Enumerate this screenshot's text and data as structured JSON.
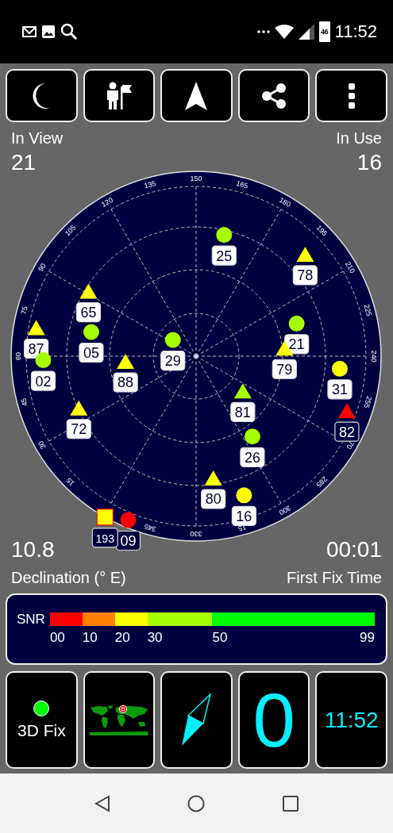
{
  "status_bar": {
    "battery": "46",
    "time": "11:52"
  },
  "toolbar": {
    "buttons": [
      {
        "kind": "moon"
      },
      {
        "kind": "person-flag"
      },
      {
        "kind": "navigation"
      },
      {
        "kind": "share"
      },
      {
        "kind": "more"
      }
    ]
  },
  "in_view": {
    "label": "In View",
    "value": "21"
  },
  "in_use": {
    "label": "In Use",
    "value": "16"
  },
  "sky_plot": {
    "azimuth_labels": [
      "15",
      "30",
      "45",
      "60",
      "75",
      "90",
      "105",
      "120",
      "135",
      "150",
      "165",
      "180",
      "195",
      "210",
      "225",
      "240",
      "255",
      "70",
      "285",
      "300",
      "15",
      "330",
      "345"
    ],
    "satellites": [
      {
        "id": "25",
        "kind": "circle",
        "color": "#a5ff00",
        "in_use": true
      },
      {
        "id": "78",
        "kind": "triangle",
        "color": "#ffff00",
        "in_use": true
      },
      {
        "id": "65",
        "kind": "triangle",
        "color": "#ffff00",
        "in_use": true
      },
      {
        "id": "87",
        "kind": "triangle",
        "color": "#ffff00",
        "in_use": true
      },
      {
        "id": "05",
        "kind": "circle",
        "color": "#a5ff00",
        "in_use": true
      },
      {
        "id": "29",
        "kind": "circle",
        "color": "#a5ff00",
        "in_use": true
      },
      {
        "id": "21",
        "kind": "circle",
        "color": "#a5ff00",
        "in_use": true
      },
      {
        "id": "79",
        "kind": "triangle",
        "color": "#ffff00",
        "in_use": true
      },
      {
        "id": "02",
        "kind": "circle",
        "color": "#a5ff00",
        "in_use": true
      },
      {
        "id": "88",
        "kind": "triangle",
        "color": "#ffff00",
        "in_use": true
      },
      {
        "id": "31",
        "kind": "circle",
        "color": "#ffff00",
        "in_use": true
      },
      {
        "id": "81",
        "kind": "triangle",
        "color": "#a5ff00",
        "in_use": true
      },
      {
        "id": "82",
        "kind": "triangle",
        "color": "#ff0000",
        "in_use": false
      },
      {
        "id": "72",
        "kind": "triangle",
        "color": "#ffff00",
        "in_use": true
      },
      {
        "id": "26",
        "kind": "circle",
        "color": "#a5ff00",
        "in_use": true
      },
      {
        "id": "80",
        "kind": "triangle",
        "color": "#ffff00",
        "in_use": true
      },
      {
        "id": "16",
        "kind": "circle",
        "color": "#ffff00",
        "in_use": true
      },
      {
        "id": "09",
        "kind": "circle",
        "color": "#ff0000",
        "in_use": false
      },
      {
        "id": "193",
        "kind": "square",
        "color": "#ffff00",
        "in_use": false
      }
    ]
  },
  "declination": {
    "value": "10.8",
    "label": "Declination (° E)"
  },
  "first_fix": {
    "value": "00:01",
    "label": "First Fix Time"
  },
  "snr": {
    "label": "SNR",
    "segments": [
      {
        "color": "#ff0000"
      },
      {
        "color": "#ff8000"
      },
      {
        "color": "#ffff00"
      },
      {
        "color": "#a8ff00"
      },
      {
        "color": "#00ff00"
      }
    ],
    "ticks": [
      "00",
      "10",
      "20",
      "30",
      "50",
      "99"
    ]
  },
  "tiles": {
    "fix": {
      "label": "3D Fix",
      "color": "#00ff00"
    },
    "speed": "0",
    "clock": "11:52"
  },
  "nav_bar": {
    "buttons": [
      {
        "kind": "back"
      },
      {
        "kind": "home"
      },
      {
        "kind": "recents"
      }
    ]
  }
}
